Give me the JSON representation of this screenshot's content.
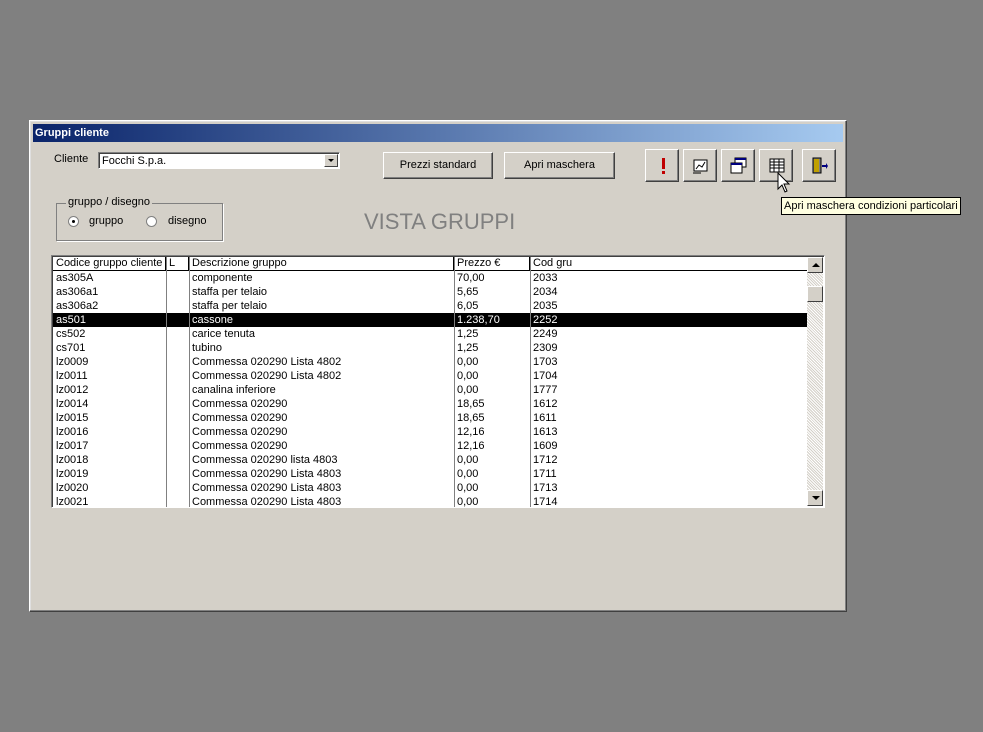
{
  "window": {
    "title": "Gruppi cliente"
  },
  "cliente": {
    "label": "Cliente",
    "value": "Focchi S.p.a."
  },
  "buttons": {
    "prezzi_standard": "Prezzi standard",
    "apri_maschera": "Apri maschera"
  },
  "icon_buttons": [
    {
      "name": "alert-icon"
    },
    {
      "name": "chart-edit-icon"
    },
    {
      "name": "windows-icon"
    },
    {
      "name": "grid-icon"
    },
    {
      "name": "exit-door-icon"
    }
  ],
  "group": {
    "title": "gruppo / disegno",
    "options": [
      "gruppo",
      "disegno"
    ],
    "selected": "gruppo"
  },
  "heading": "VISTA GRUPPI",
  "table": {
    "columns": [
      "Codice gruppo cliente",
      "L",
      "Descrizione gruppo",
      "Prezzo €",
      "Cod gru"
    ],
    "selected_row": 3,
    "rows": [
      [
        "as305A",
        "",
        "componente",
        "70,00",
        "2033"
      ],
      [
        "as306a1",
        "",
        "staffa per telaio",
        "5,65",
        "2034"
      ],
      [
        "as306a2",
        "",
        "staffa per telaio",
        "6,05",
        "2035"
      ],
      [
        "as501",
        "",
        "cassone",
        "1.238,70",
        "2252"
      ],
      [
        "cs502",
        "",
        "carice tenuta",
        "1,25",
        "2249"
      ],
      [
        "cs701",
        "",
        "tubino",
        "1,25",
        "2309"
      ],
      [
        "lz0009",
        "",
        "Commessa 020290 Lista 4802",
        "0,00",
        "1703"
      ],
      [
        "lz0011",
        "",
        "Commessa 020290 Lista 4802",
        "0,00",
        "1704"
      ],
      [
        "lz0012",
        "",
        "canalina inferiore",
        "0,00",
        "1777"
      ],
      [
        "lz0014",
        "",
        "Commessa 020290",
        "18,65",
        "1612"
      ],
      [
        "lz0015",
        "",
        "Commessa 020290",
        "18,65",
        "1611"
      ],
      [
        "lz0016",
        "",
        "Commessa 020290",
        "12,16",
        "1613"
      ],
      [
        "lz0017",
        "",
        "Commessa 020290",
        "12,16",
        "1609"
      ],
      [
        "lz0018",
        "",
        "Commessa 020290 lista 4803",
        "0,00",
        "1712"
      ],
      [
        "lz0019",
        "",
        "Commessa 020290 Lista 4803",
        "0,00",
        "1711"
      ],
      [
        "lz0020",
        "",
        "Commessa 020290 Lista 4803",
        "0,00",
        "1713"
      ],
      [
        "lz0021",
        "",
        "Commessa 020290 Lista 4803",
        "0,00",
        "1714"
      ]
    ]
  },
  "tooltip": "Apri maschera condizioni particolari",
  "colors": {
    "desktop": "#808080",
    "face": "#d4d0c8",
    "title_start": "#0a246a",
    "title_end": "#a6caf0",
    "alert": "#c00000"
  }
}
